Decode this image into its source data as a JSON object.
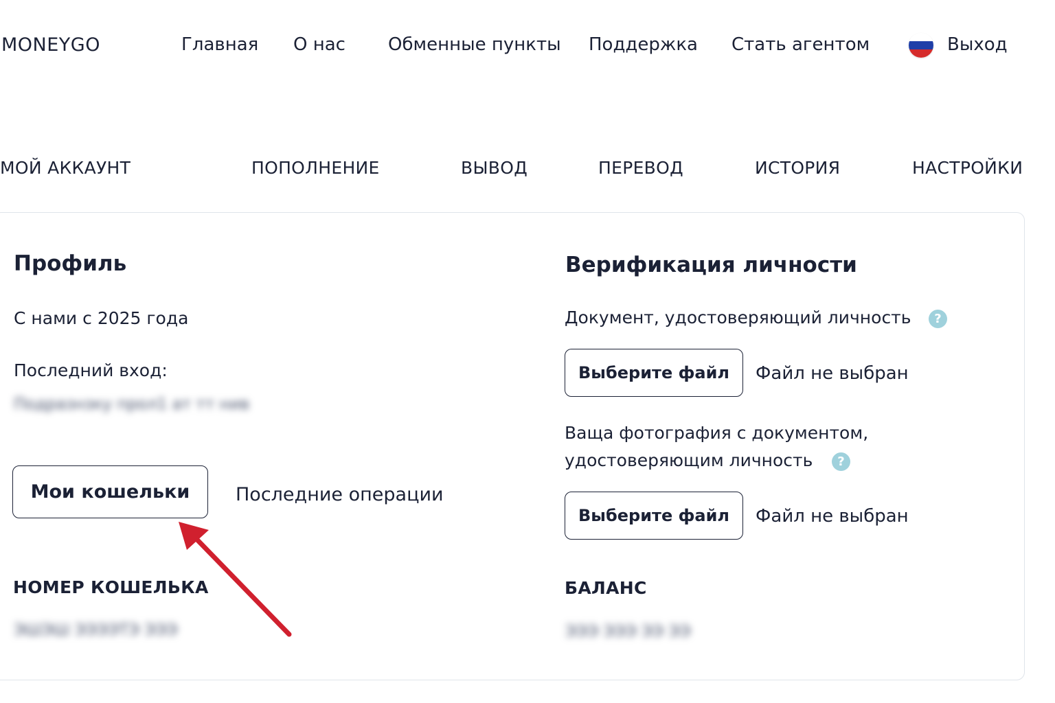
{
  "header": {
    "logo": "MONEYGO",
    "nav": [
      "Главная",
      "О нас",
      "Обменные пункты",
      "Поддержка",
      "Стать агентом"
    ],
    "logout": "Выход",
    "flag_colors": [
      "#ffffff",
      "#1f3fa8",
      "#d52b2b"
    ]
  },
  "tabs": [
    "МОЙ АККАУНТ",
    "ПОПОЛНЕНИЕ",
    "ВЫВОД",
    "ПЕРЕВОД",
    "ИСТОРИЯ",
    "НАСТРОЙКИ"
  ],
  "profile": {
    "title": "Профиль",
    "member_since": "С нами с 2025 года",
    "last_login_label": "Последний вход:",
    "last_login_value": "Подразнзку прол1 ат тт нив",
    "wallets_button": "Мои кошельки",
    "recent_ops_link": "Последние операции",
    "wallet_number_label": "НОМЕР КОШЕЛЬКА",
    "wallet_number_value": "ЭШЭШ ЭЭЭЭТЭ ЭЭЭ"
  },
  "verification": {
    "title": "Верификация личности",
    "doc_label": "Документ, удостоверяющий личность",
    "choose_file_1": "Выберите файл",
    "no_file_1": "Файл не выбран",
    "photo_label_line1": "Ваща фотография с документом,",
    "photo_label_line2": "удостоверяющим личность",
    "choose_file_2": "Выберите файл",
    "no_file_2": "Файл не выбран",
    "help_glyph": "?",
    "balance_label": "БАЛАНС",
    "balance_value": "ЭЭЭ ЭЭЭ ЭЭ ЭЭ"
  },
  "colors": {
    "text": "#1b2135",
    "arrow": "#d0202e",
    "help": "#9fd1dc",
    "card_border": "#dfe4ea"
  }
}
